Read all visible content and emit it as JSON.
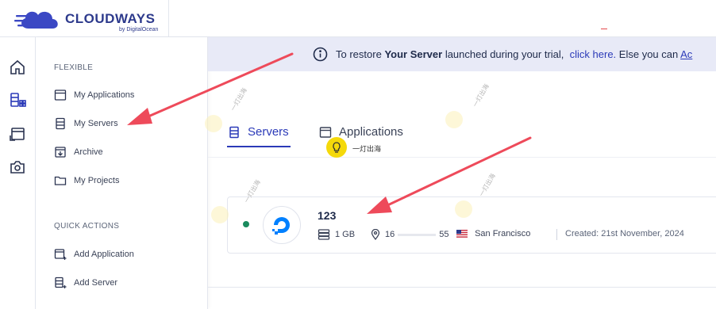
{
  "brand": {
    "name": "CLOUDWAYS",
    "subtitle": "by DigitalOcean"
  },
  "sidebar": {
    "sections": [
      {
        "title": "FLEXIBLE",
        "items": [
          {
            "label": "My Applications",
            "icon": "window-icon"
          },
          {
            "label": "My Servers",
            "icon": "server-icon"
          },
          {
            "label": "Archive",
            "icon": "archive-icon"
          },
          {
            "label": "My Projects",
            "icon": "folder-icon"
          }
        ]
      },
      {
        "title": "QUICK ACTIONS",
        "items": [
          {
            "label": "Add Application",
            "icon": "add-window-icon"
          },
          {
            "label": "Add Server",
            "icon": "add-server-icon"
          }
        ]
      }
    ]
  },
  "banner": {
    "prefix": "To restore",
    "bold": "Your Server",
    "middle": "launched during your trial,",
    "link": "click here.",
    "suffix": "Else you can",
    "link2": "Ac"
  },
  "tabs": [
    {
      "label": "Servers",
      "active": true
    },
    {
      "label": "Applications",
      "active": false
    }
  ],
  "server": {
    "name": "123",
    "size": "1 GB",
    "ip": "16",
    "ip_tail": "55",
    "location": "San Francisco",
    "created": "Created: 21st November, 2024",
    "status_color": "#1a8b5e"
  },
  "watermark": {
    "text": "一灯出海"
  },
  "colors": {
    "accent": "#2b3ab8",
    "banner_bg": "#e8eaf7",
    "arrow": "#ee4a5a"
  }
}
